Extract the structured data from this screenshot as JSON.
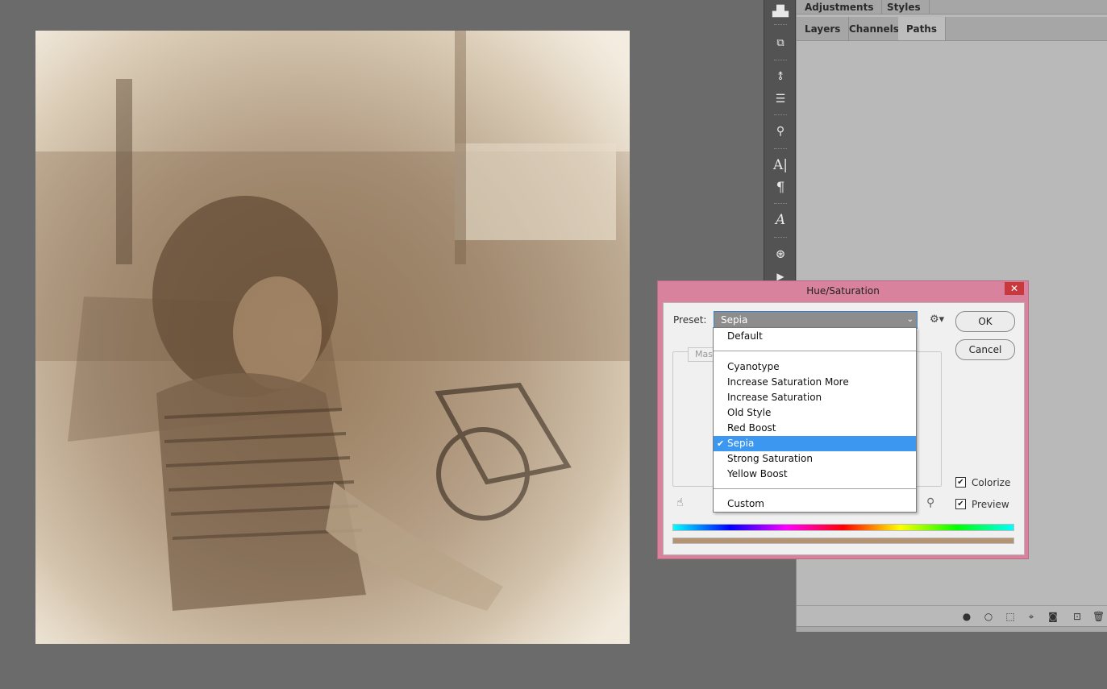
{
  "panel": {
    "top_tabs": [
      "Adjustments",
      "Styles"
    ],
    "tabs": [
      "Layers",
      "Channels",
      "Paths"
    ],
    "active_tab": "Paths"
  },
  "dialog": {
    "title": "Hue/Saturation",
    "close_glyph": "✕",
    "preset_label": "Preset:",
    "preset_value": "Sepia",
    "master_tab": "Mas",
    "ok": "OK",
    "cancel": "Cancel",
    "colorize_label": "Colorize",
    "colorize_checked": true,
    "preview_label": "Preview",
    "preview_checked": true
  },
  "dropdown": {
    "options": {
      "default": "Default",
      "cyanotype": "Cyanotype",
      "increase_saturation_more": "Increase Saturation More",
      "increase_saturation": "Increase Saturation",
      "old_style": "Old Style",
      "red_boost": "Red Boost",
      "sepia": "Sepia",
      "strong_saturation": "Strong Saturation",
      "yellow_boost": "Yellow Boost",
      "custom": "Custom"
    },
    "selected": "Sepia"
  },
  "tools": {
    "type_glyph": "A|",
    "paragraph_glyph": "¶",
    "glyph_glyph": "A",
    "play_glyph": "▶"
  },
  "colors": {
    "dialog_frame": "#d8829d",
    "selection": "#3b97f0",
    "sepia_result": "#b49274"
  }
}
